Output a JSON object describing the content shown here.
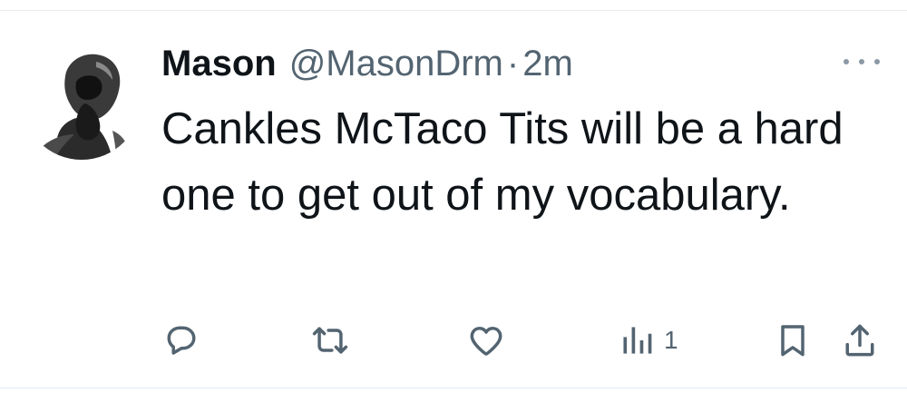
{
  "tweet": {
    "author": {
      "display_name": "Mason",
      "handle": "@MasonDrm"
    },
    "separator": "·",
    "timestamp": "2m",
    "text": "Cankles McTaco Tits will be a hard one to get out of my vocabulary."
  },
  "actions": {
    "reply_icon": "reply-icon",
    "retweet_icon": "retweet-icon",
    "like_icon": "heart-icon",
    "views_icon": "views-chart-icon",
    "views_count": "1",
    "bookmark_icon": "bookmark-icon",
    "share_icon": "share-icon"
  },
  "colors": {
    "text_primary": "#0f1419",
    "text_secondary": "#536471",
    "icon": "#536471",
    "divider": "#e6ecf0"
  }
}
